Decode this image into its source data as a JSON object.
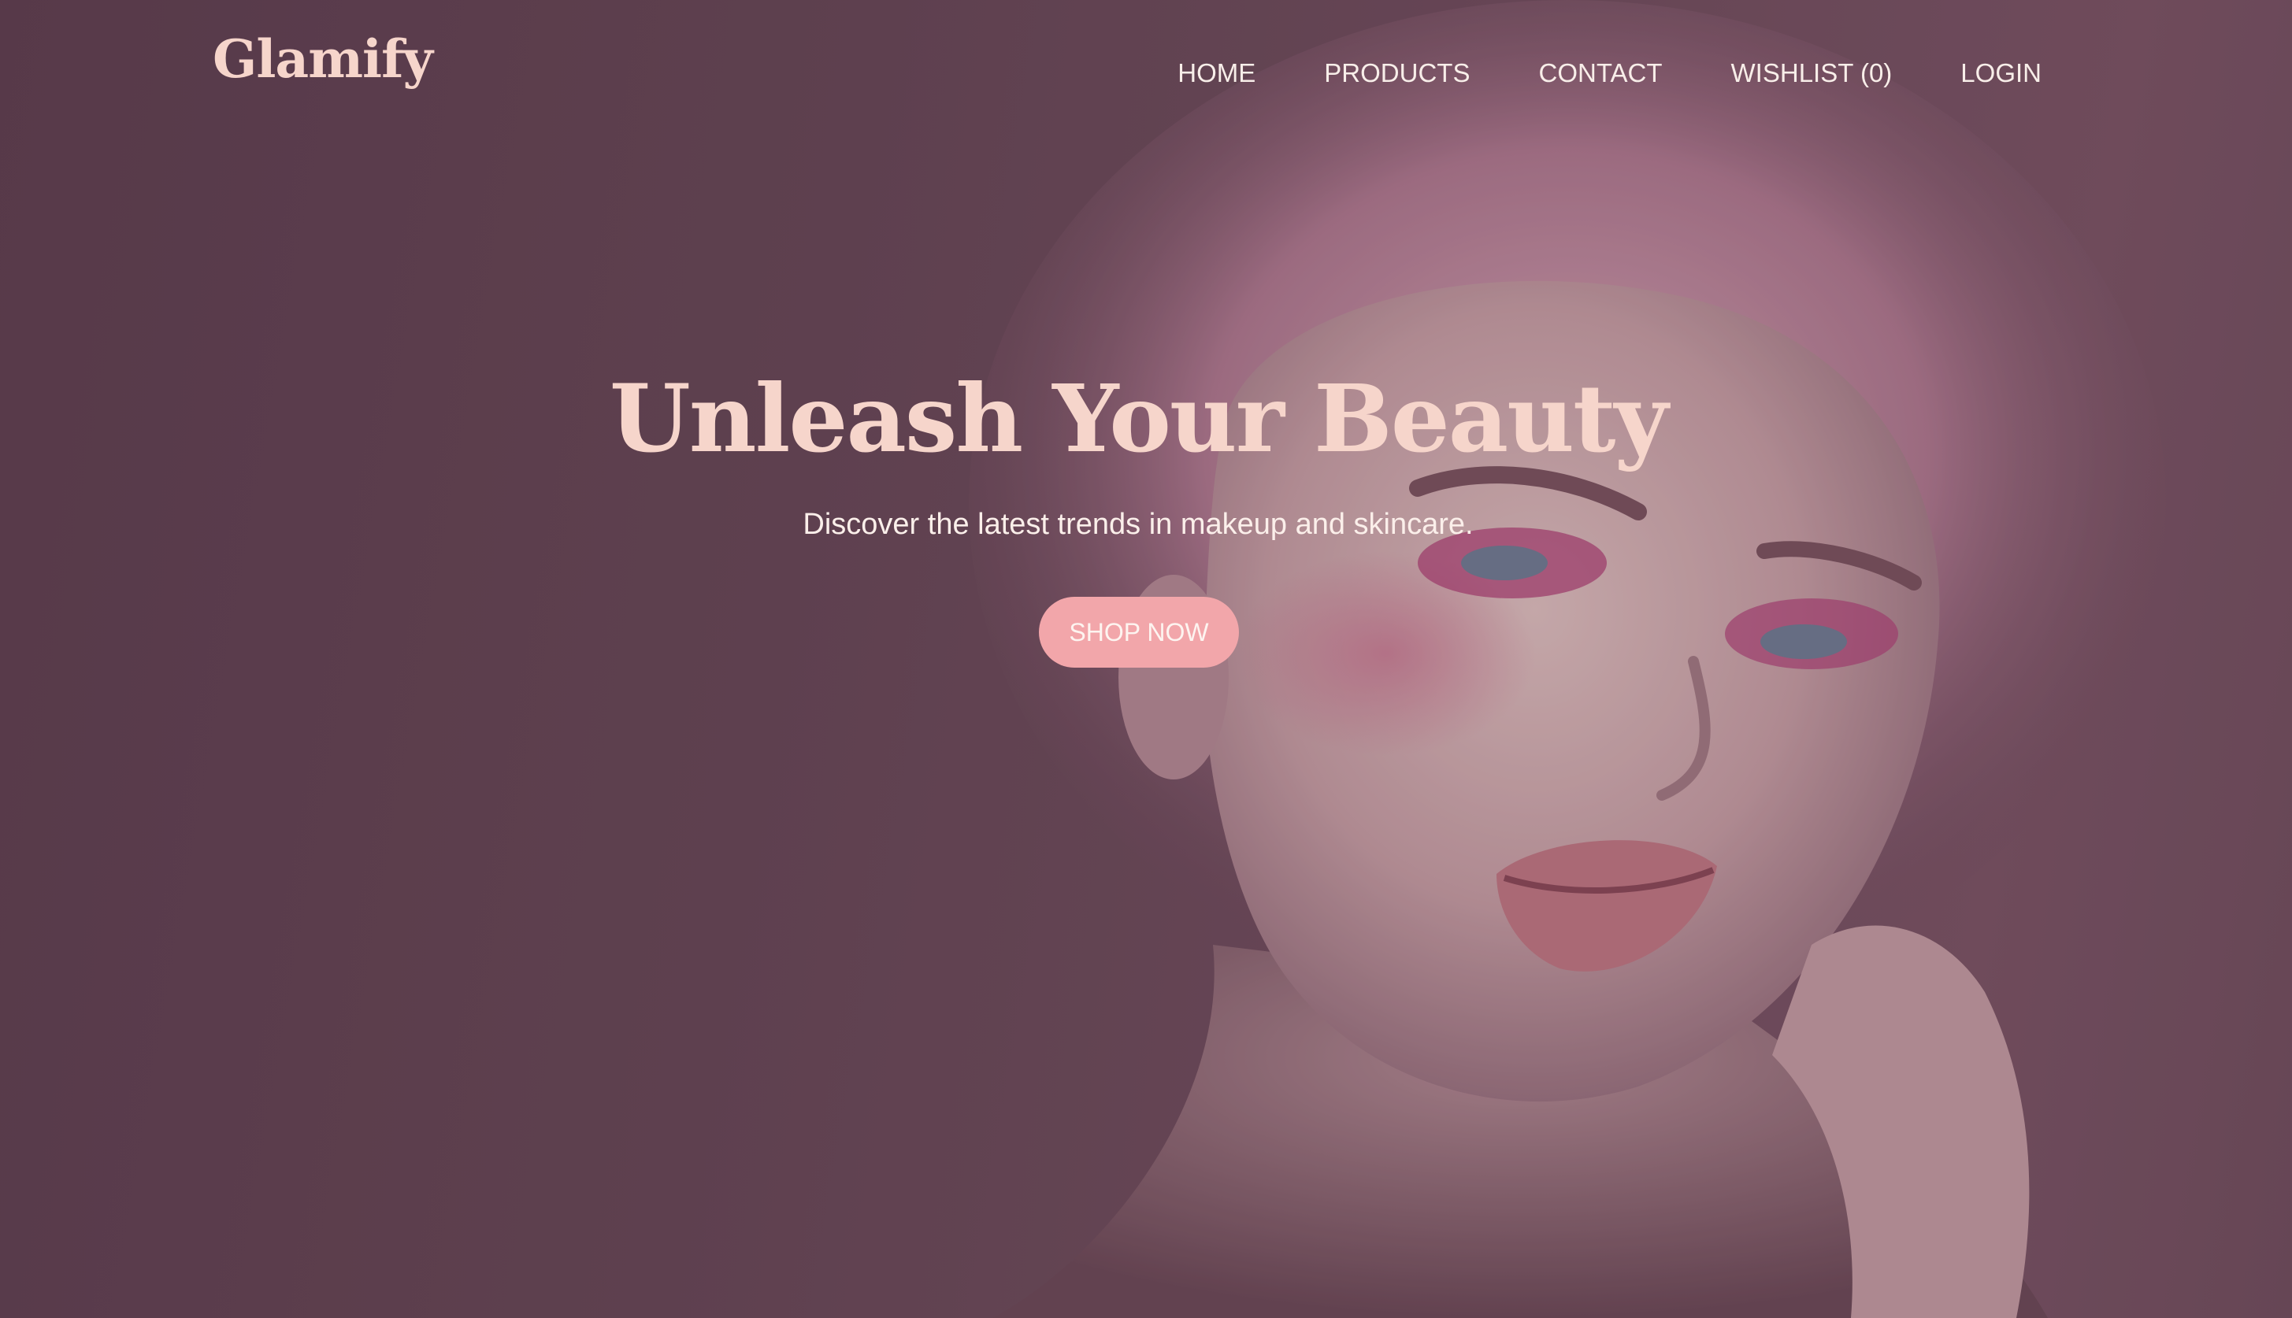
{
  "brand": {
    "logo_text": "Glamify"
  },
  "nav": {
    "items": [
      {
        "label": "HOME"
      },
      {
        "label": "PRODUCTS"
      },
      {
        "label": "CONTACT"
      },
      {
        "label": "WISHLIST (0)"
      },
      {
        "label": "LOGIN"
      }
    ]
  },
  "hero": {
    "headline": "Unleash Your Beauty",
    "subtitle": "Discover the latest trends in makeup and skincare.",
    "cta_label": "SHOP NOW"
  },
  "colors": {
    "background": "#664957",
    "accent_text": "#f6d5cb",
    "cta_background": "#f2a6aa",
    "nav_text": "#f8eee9"
  }
}
